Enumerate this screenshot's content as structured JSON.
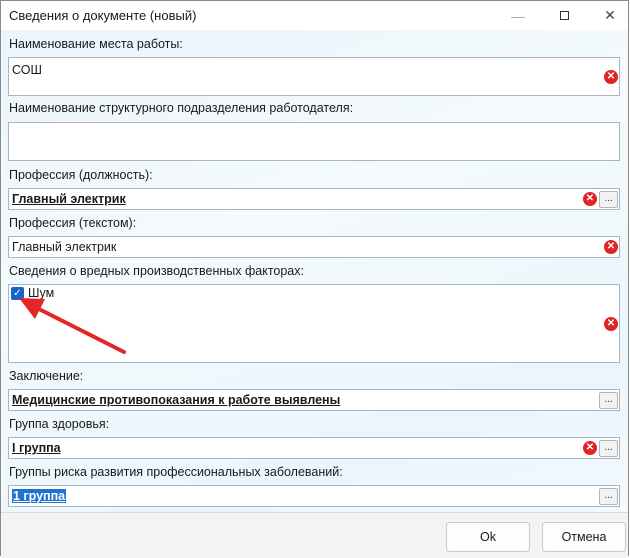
{
  "window": {
    "title": "Сведения о документе (новый)",
    "minimize_glyph": "—",
    "close_glyph": "✕"
  },
  "fields": {
    "workplace": {
      "label": "Наименование места работы:",
      "value": "СОШ"
    },
    "department": {
      "label": "Наименование структурного подразделения работодателя:",
      "value": ""
    },
    "profession": {
      "label": "Профессия (должность):",
      "value": "Главный электрик"
    },
    "profession_text": {
      "label": "Профессия (текстом):",
      "value": "Главный электрик"
    },
    "hazards": {
      "label": "Сведения о вредных производственных факторах:",
      "items": [
        {
          "label": "Шум",
          "checked": true
        }
      ]
    },
    "conclusion": {
      "label": "Заключение:",
      "value": "Медицинские противопоказания к работе выявлены"
    },
    "health_group": {
      "label": "Группа здоровья:",
      "value": "I группа"
    },
    "risk_groups": {
      "label": "Группы риска развития профессиональных заболеваний:",
      "value": "1 группа"
    }
  },
  "icons": {
    "error_glyph": "✕",
    "ellipsis_glyph": "...",
    "check_glyph": "✓"
  },
  "annotation": {
    "arrow_color": "#e32626"
  },
  "buttons": {
    "ok": "Ok",
    "cancel": "Отмена"
  }
}
